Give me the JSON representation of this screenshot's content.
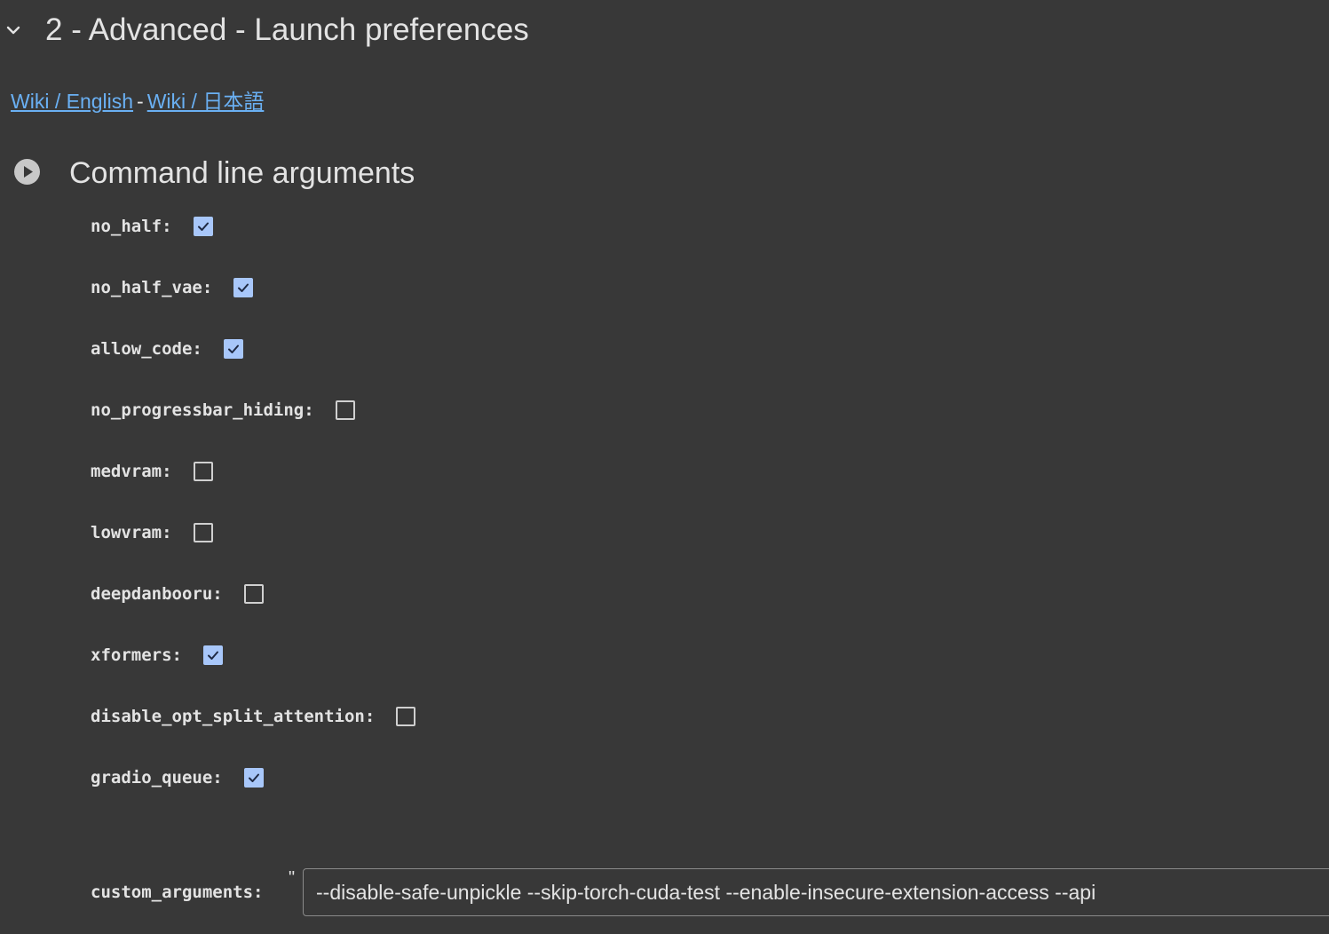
{
  "section": {
    "title": "2 - Advanced - Launch preferences",
    "toggle_icon": "chevron-down-icon"
  },
  "links": {
    "english": "Wiki / English",
    "separator": "-",
    "japanese": "Wiki / 日本語"
  },
  "form": {
    "title": "Command line arguments",
    "run_icon": "play-circle-icon",
    "params": [
      {
        "label": "no_half:",
        "checked": true
      },
      {
        "label": "no_half_vae:",
        "checked": true
      },
      {
        "label": "allow_code:",
        "checked": true
      },
      {
        "label": "no_progressbar_hiding:",
        "checked": false
      },
      {
        "label": "medvram:",
        "checked": false
      },
      {
        "label": "lowvram:",
        "checked": false
      },
      {
        "label": "deepdanbooru:",
        "checked": false
      },
      {
        "label": "xformers:",
        "checked": true
      },
      {
        "label": "disable_opt_split_attention:",
        "checked": false
      },
      {
        "label": "gradio_queue:",
        "checked": true
      }
    ],
    "custom_arguments": {
      "label": "custom_arguments:",
      "quote": "\"",
      "value": "--disable-safe-unpickle --skip-torch-cuda-test --enable-insecure-extension-access --api"
    }
  },
  "colors": {
    "background": "#383838",
    "link": "#6ab0f3",
    "checkbox_checked": "#a8c7fa",
    "text": "#e3e3e3"
  }
}
